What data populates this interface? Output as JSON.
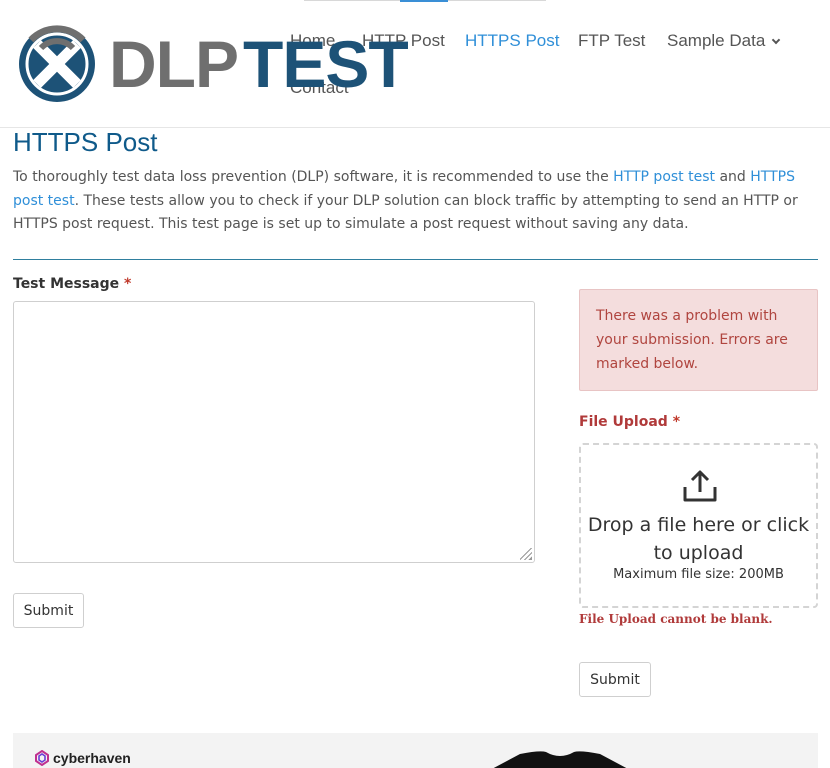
{
  "header": {
    "logo": {
      "part1": "DLP",
      "part2": "TEST"
    },
    "nav": [
      {
        "label": "Home",
        "active": false
      },
      {
        "label": "HTTP Post",
        "active": false
      },
      {
        "label": "HTTPS Post",
        "active": true
      },
      {
        "label": "FTP Test",
        "active": false
      },
      {
        "label": "Sample Data",
        "active": false,
        "has_dropdown": true
      },
      {
        "label": "Contact",
        "active": false
      }
    ]
  },
  "page": {
    "title": "HTTPS Post",
    "intro": {
      "pre": "To thoroughly test data loss prevention (DLP) software, it is recommended to use the ",
      "link1": "HTTP post test",
      "mid": " and ",
      "link2": "HTTPS post test",
      "post": ". These tests allow you to check if your DLP solution can block traffic by attempting to send an HTTP or HTTPS post request. This test page is set up to simulate a post request without saving any data."
    }
  },
  "form_left": {
    "label": "Test Message",
    "required_mark": "*",
    "message_value": "",
    "submit_label": "Submit"
  },
  "form_right": {
    "alert": "There was a problem with your submission. Errors are marked below.",
    "upload_label": "File Upload",
    "required_mark": "*",
    "dropzone_main": "Drop a file here or click to upload",
    "dropzone_sub": "Maximum file size: 200MB",
    "error": "File Upload cannot be blank.",
    "submit_label": "Submit"
  },
  "footer": {
    "sponsor": "cyberhaven"
  },
  "colors": {
    "accent": "#2f8fd8",
    "title": "#0f5a8a",
    "logo_gray": "#6f6f6f",
    "logo_blue": "#1d5277",
    "error": "#b03a3a",
    "alert_bg": "#f4dddd"
  },
  "icons": {
    "logo_mark": "dlp-x-wifi-icon",
    "upload": "upload-icon",
    "chevron": "chevron-down-icon",
    "sponsor": "cyberhaven-icon"
  }
}
